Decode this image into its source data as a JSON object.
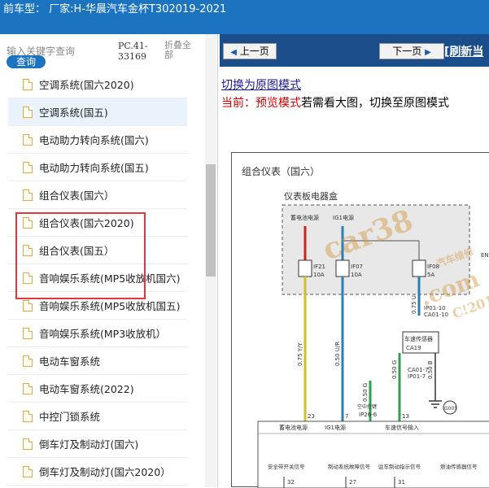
{
  "topbar": {
    "title": "前车型：  厂家:H-华晨汽车金杯T302019-2021"
  },
  "search": {
    "placeholder": "输入关键字查询",
    "button": "查询",
    "code": "PC.41-33169",
    "fold": "折叠全部"
  },
  "list": [
    "空调系统(国六2020)",
    "空调系统(国五)",
    "电动助力转向系统(国六)",
    "电动助力转向系统(国五)",
    "组合仪表(国六）",
    "组合仪表(国六2020)",
    "组合仪表(国五）",
    "音响娱乐系统(MP5收放机国六)",
    "音响娱乐系统(MP5收放机国五)",
    "音响娱乐系统(MP3收放机）",
    "电动车窗系统",
    "电动车窗系统(2022)",
    "中控门锁系统",
    "倒车灯及制动灯(国六)",
    "倒车灯及制动灯(国六2020）"
  ],
  "nav": {
    "prev": "上一页",
    "next": "下一页",
    "refresh": "[刷新当"
  },
  "content": {
    "switch_link": "切换为原图模式",
    "mode_label": "当前：预览模式",
    "mode_hint": "若需看大图，切换至原图模式"
  },
  "diagram": {
    "title": "组合仪表（国六）",
    "box_title": "仪表板电器盒",
    "labels": {
      "battery": "蓄电池电源",
      "ig1": "IG1电源",
      "f21": "IF21",
      "f21a": "10A",
      "f07": "IF07",
      "f07a": "10A",
      "f08": "IF08",
      "f08a": "5A",
      "ip": "IP01-10",
      "ca": "CA01-10",
      "w1": "0.75 Y/Y",
      "w2": "0.50 U/R",
      "w3": "0.75 U",
      "sensor": "车速传感器",
      "sensor_id": "CA19",
      "ca2": "CA01-7",
      "ip2": "IP01-7",
      "w4": "0.50 G",
      "w5": "0.50 G",
      "w6": "0.50 B",
      "ip26": "IP26-6",
      "ctrl": "空中控键",
      "g005": "G005",
      "p23": "23",
      "p7": "7",
      "p13": "13",
      "b1": "蓄电池电源",
      "b2": "IG1电源",
      "b3": "车速信号输入",
      "c1": "安全带开关信号",
      "c2": "制动系统故障信号",
      "c3": "驻车制动指示信号",
      "c4": "燃油传感器信号",
      "p32": "32",
      "p27": "27",
      "p31": "31",
      "en": "EN",
      "wm1": "car38",
      "wm2": ".com",
      "wm3": "汽车维修",
      "wm4": "C!201"
    }
  },
  "colors": {
    "topbar": "#1c74c0",
    "nav": "#1b4d8b",
    "highlight": "#e0383a",
    "link": "#1a1aa0",
    "red": "#d10000"
  }
}
